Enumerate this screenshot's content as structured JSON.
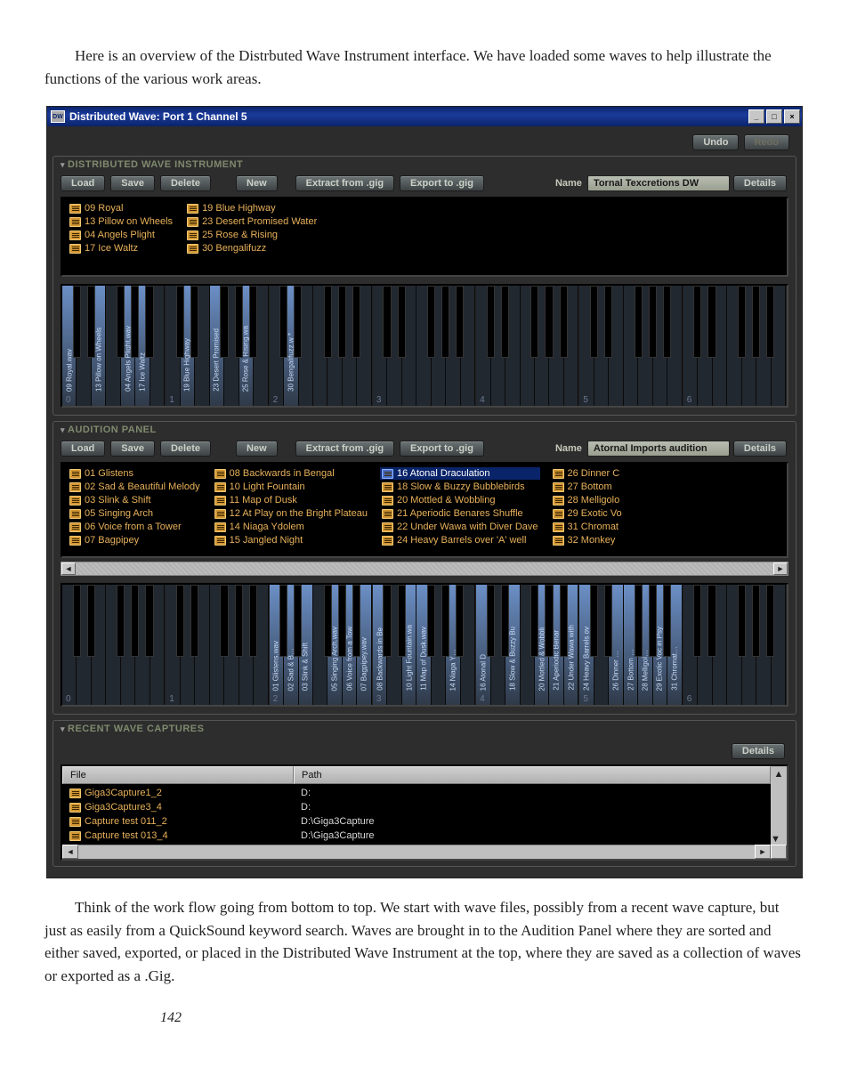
{
  "intro_text": "Here is an overview of the Distrbuted Wave Instrument interface. We have loaded some waves to help illustrate the functions of the various work areas.",
  "outro_text": "Think of the work flow going from bottom to top. We start with wave files, possibly from a recent wave capture, but just as easily from a QuickSound keyword search. Waves are brought in to the Audition Panel where they are sorted and either saved, exported, or placed in the Distributed Wave Instrument at the top, where they are saved as a collection of waves or exported as a .Gig.",
  "page_number": "142",
  "window": {
    "title": "Distributed Wave: Port 1 Channel 5",
    "icon_label": "DW",
    "undo": "Undo",
    "redo": "Redo"
  },
  "toolbar": {
    "load": "Load",
    "save": "Save",
    "delete": "Delete",
    "new": "New",
    "extract": "Extract from .gig",
    "export": "Export to .gig",
    "name_label": "Name",
    "details": "Details"
  },
  "dwi_panel": {
    "title": "DISTRIBUTED WAVE INSTRUMENT",
    "name_value": "Tornal Texcretions DW",
    "cols": [
      [
        "09 Royal",
        "13 Pillow on Wheels",
        "04 Angels Plight",
        "17 Ice Waltz"
      ],
      [
        "19 Blue Highway",
        "23 Desert Promised Water",
        "25 Rose & Rising",
        "30 Bengalifuzz"
      ]
    ],
    "kb_labels": {
      "0": [
        "09 Royal.wav",
        "",
        "13 Pillow on Wheels",
        "",
        "04 Angels Plight.wav",
        "17 Ice Waltz",
        ""
      ],
      "1": [
        "",
        "19 Blue Highway",
        "",
        "23 Desert Promised",
        "",
        "25 Rose & Rising.wa",
        ""
      ],
      "2": [
        "",
        "30 Bengalifuzz.w *",
        "",
        "",
        "",
        "",
        ""
      ]
    }
  },
  "audition_panel": {
    "title": "AUDITION PANEL",
    "name_value": "Atornal Imports audition",
    "selected_index": {
      "col": 2,
      "row": 0
    },
    "cols": [
      [
        "01 Glistens",
        "02 Sad & Beautiful Melody",
        "03 Slink & Shift",
        "05 Singing Arch",
        "06 Voice from a Tower",
        "07 Bagpipey"
      ],
      [
        "08 Backwards in Bengal",
        "10 Light Fountain",
        "11 Map of Dusk",
        "12 At Play on the Bright Plateau",
        "14 Niaga Ydolem",
        "15 Jangled Night"
      ],
      [
        "16 Atonal Draculation",
        "18 Slow & Buzzy Bubblebirds",
        "20 Mottled & Wobbling",
        "21 Aperiodic Benares Shuffle",
        "22 Under Wawa with Diver Dave",
        "24 Heavy Barrels over 'A' well"
      ],
      [
        "26 Dinner C",
        "27 Bottom",
        "28 Melligolo",
        "29 Exotic Vo",
        "31 Chromat",
        "32 Monkey"
      ]
    ],
    "kb_labels": {
      "2": [
        "01 Glistens.wav",
        "02 Sad & B…",
        "03 Slink & Shift",
        "",
        "05 Singing Arch.wav",
        "06 Voice from a Tow",
        "07 Bagpipey.wav"
      ],
      "3": [
        "08 Backwards in Be",
        "",
        "10 Light Fountain.wa",
        "11 Map of Dusk.wav",
        "",
        "14 Niaga Y…",
        ""
      ],
      "4": [
        "16 Atonal D",
        "",
        "18 Slow & Buzzy Bu",
        "",
        "20 Mottled & Wobbli",
        "21 Aperiodic Benar",
        "22 Under Wawa with"
      ],
      "5": [
        "24 Heavy Barrels ov",
        "",
        "26 Dinner …",
        "27 Bottom …",
        "28 Melligol…",
        "29 Exotic Voc in Psy",
        "31 Chromat…"
      ]
    }
  },
  "recent_panel": {
    "title": "RECENT WAVE CAPTURES",
    "headers": {
      "file": "File",
      "path": "Path"
    },
    "rows": [
      {
        "file": "Giga3Capture1_2",
        "path": "D:"
      },
      {
        "file": "Giga3Capture3_4",
        "path": "D:"
      },
      {
        "file": "Capture test 011_2",
        "path": "D:\\Giga3Capture"
      },
      {
        "file": "Capture test 013_4",
        "path": "D:\\Giga3Capture"
      }
    ]
  }
}
